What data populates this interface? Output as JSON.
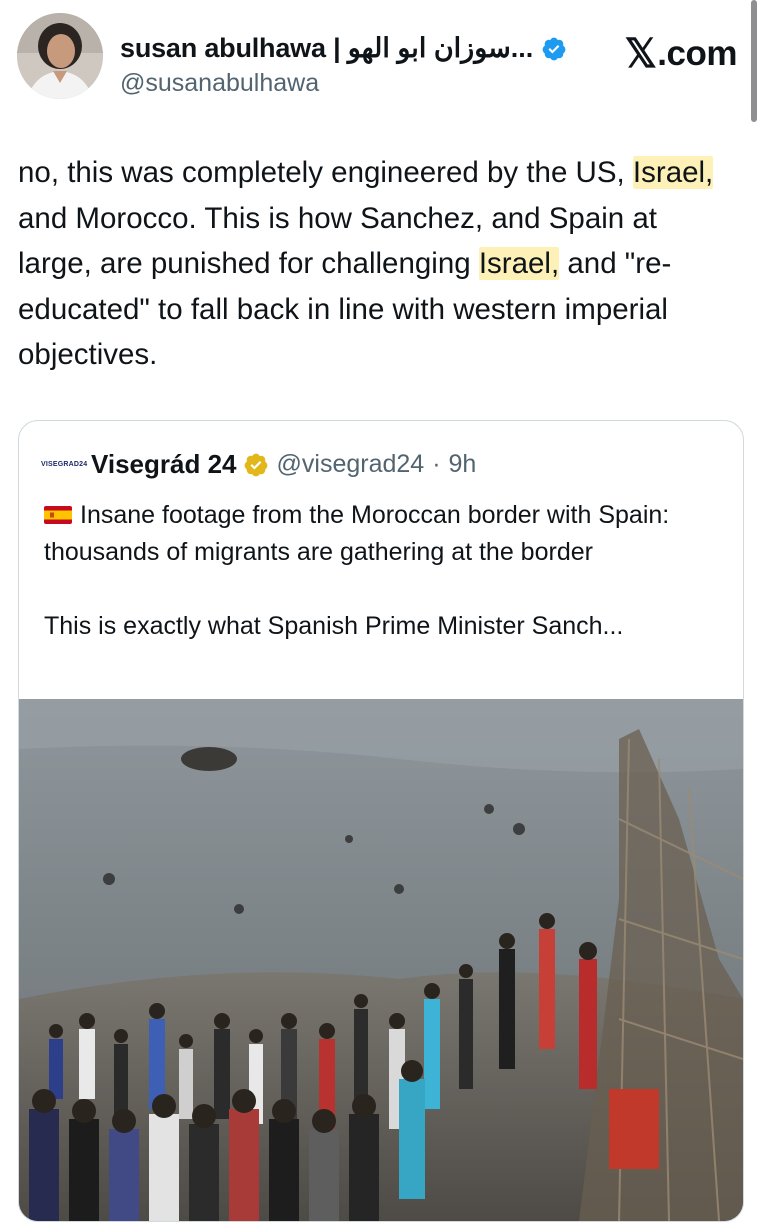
{
  "post": {
    "author_name": "susan abulhawa | سوزان ابو الهو...",
    "author_handle": "@susanabulhawa",
    "site": ".com",
    "text_segments": [
      {
        "text": "no, this was completely engineered by the US, ",
        "highlight": false
      },
      {
        "text": "Israel,",
        "highlight": true
      },
      {
        "text": " and Morocco.  This is how Sanchez, and Spain at large, are punished for challenging ",
        "highlight": false
      },
      {
        "text": "Israel,",
        "highlight": true
      },
      {
        "text": " and \"re-educated\" to fall back in line with western imperial objectives.",
        "highlight": false
      }
    ]
  },
  "quote": {
    "logo_text": "VISEGRAD24",
    "author_name": "Visegrád 24",
    "author_handle": "@visegrad24",
    "separator": "·",
    "time": "9h",
    "paragraph1": "Insane footage from the Moroccan border with Spain: thousands of migrants are gathering at the border",
    "paragraph2": "This is exactly what Spanish Prime Minister Sanch..."
  },
  "colors": {
    "verified_blue": "#1d9bf0",
    "verified_gold": "#e2b719",
    "highlight": "#fdf1b8",
    "secondary_text": "#536471"
  },
  "icons": {
    "verified": "verified-badge-icon",
    "gold_verified": "gold-verified-badge-icon",
    "x_logo": "x-logo-icon",
    "flag": "spain-flag-icon"
  }
}
